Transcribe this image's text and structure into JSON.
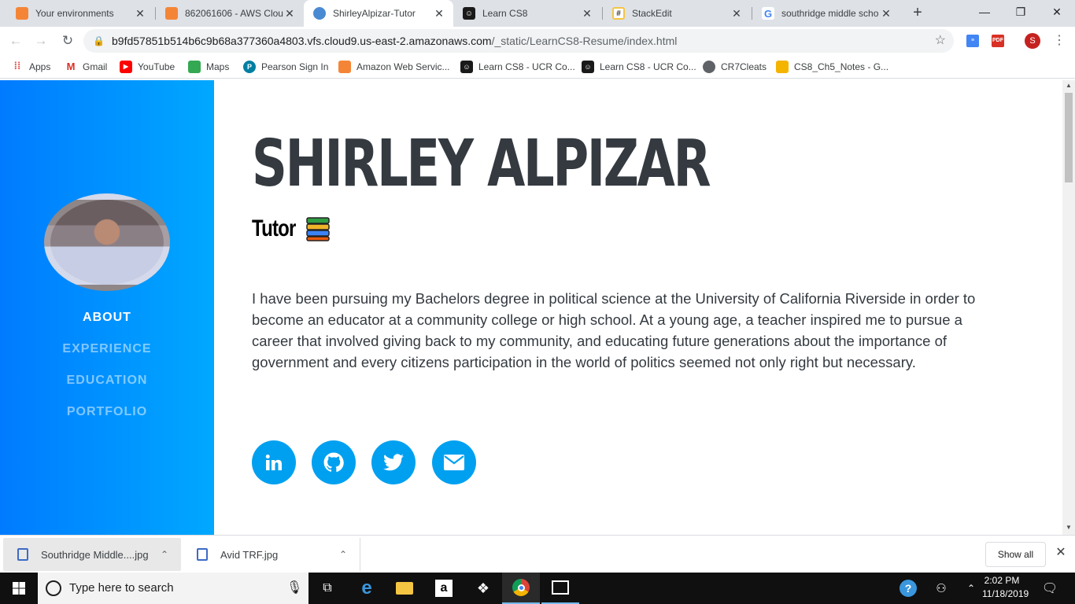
{
  "tabs": [
    {
      "title": "Your environments",
      "favicon": "aws-cube-icon",
      "color": "#f58536"
    },
    {
      "title": "862061606 - AWS Cloud",
      "favicon": "aws-cube-icon",
      "color": "#f58536"
    },
    {
      "title": "ShirleyAlpizar-Tutor",
      "favicon": "cloud9-icon",
      "color": "#4a8ad2",
      "active": true
    },
    {
      "title": "Learn CS8",
      "favicon": "learncs8-icon",
      "color": "#1a1a1a"
    },
    {
      "title": "StackEdit",
      "favicon": "stackedit-icon",
      "color": "#f4c542"
    },
    {
      "title": "southridge middle scho",
      "favicon": "google-icon",
      "color": "#4285f4"
    }
  ],
  "address_bar": {
    "host": "b9fd57851b514b6c9b68a377360a4803.vfs.cloud9.us-east-2.amazonaws.com",
    "path": "/_static/LearnCS8-Resume/index.html"
  },
  "bookmarks": [
    {
      "label": "Apps",
      "icon": "apps-grid-icon",
      "color": "#e8453c"
    },
    {
      "label": "Gmail",
      "icon": "gmail-icon",
      "color": "#d93025"
    },
    {
      "label": "YouTube",
      "icon": "youtube-icon",
      "color": "#ff0000"
    },
    {
      "label": "Maps",
      "icon": "maps-icon",
      "color": "#34a853"
    },
    {
      "label": "Pearson Sign In",
      "icon": "pearson-icon",
      "color": "#007fa3"
    },
    {
      "label": "Amazon Web Servic...",
      "icon": "aws-cube-icon",
      "color": "#f58536"
    },
    {
      "label": "Learn CS8 - UCR Co...",
      "icon": "learncs8-icon",
      "color": "#1a1a1a"
    },
    {
      "label": "Learn CS8 - UCR Co...",
      "icon": "learncs8-icon",
      "color": "#1a1a1a"
    },
    {
      "label": "CR7Cleats",
      "icon": "globe-icon",
      "color": "#5f6368"
    },
    {
      "label": "CS8_Ch5_Notes - G...",
      "icon": "slides-icon",
      "color": "#f4b400"
    }
  ],
  "sidebar": {
    "nav": [
      {
        "label": "ABOUT",
        "active": true
      },
      {
        "label": "EXPERIENCE",
        "active": false
      },
      {
        "label": "EDUCATION",
        "active": false
      },
      {
        "label": "PORTFOLIO",
        "active": false
      }
    ],
    "gradient_start": "#007bff",
    "gradient_end": "#00a8ff"
  },
  "profile": {
    "name": "SHIRLEY ALPIZAR",
    "role": "Tutor",
    "role_emoji": "books-icon",
    "bio": "I have been pursuing my Bachelors degree in political science at the University of California Riverside in order to become an educator at a community college or high school. At a young age, a teacher inspired me to pursue a career that involved giving back to my community, and educating future generations about the importance of government and every citizens participation in the world of politics seemed not only right but necessary.",
    "social": [
      "linkedin-icon",
      "github-icon",
      "twitter-icon",
      "envelope-icon"
    ],
    "social_color": "#00a0f0"
  },
  "downloads": [
    {
      "filename": "Southridge Middle....jpg"
    },
    {
      "filename": "Avid TRF.jpg"
    }
  ],
  "downloads_show_all": "Show all",
  "taskbar": {
    "search_placeholder": "Type here to search",
    "time": "2:02 PM",
    "date": "11/18/2019"
  },
  "profile_initial": "S"
}
